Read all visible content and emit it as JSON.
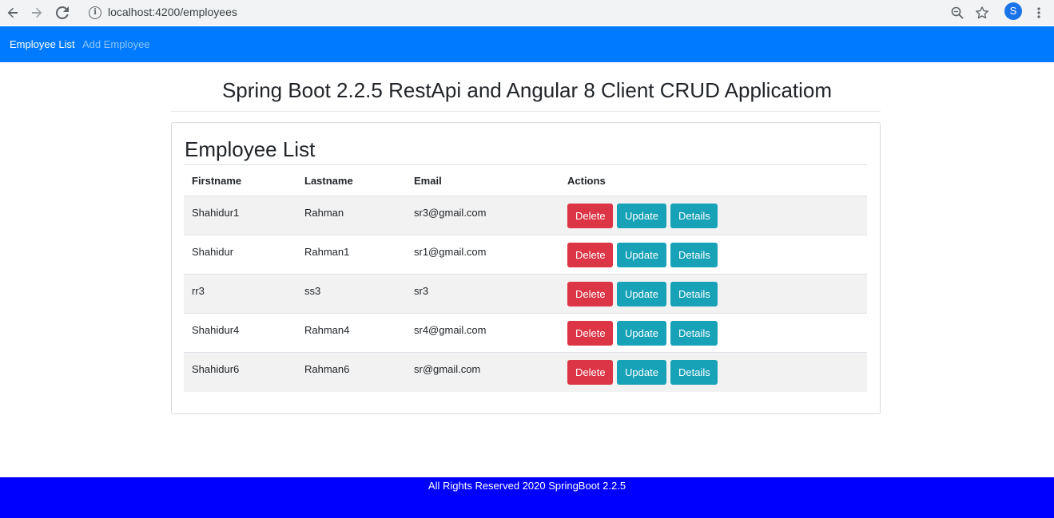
{
  "browser": {
    "url": "localhost:4200/employees",
    "profile_initial": "S",
    "icons": [
      "back-arrow-icon",
      "forward-arrow-icon",
      "reload-icon",
      "info-icon",
      "zoom-icon",
      "star-icon",
      "kebab-menu-icon"
    ]
  },
  "navbar": {
    "links": [
      {
        "label": "Employee List",
        "active": true
      },
      {
        "label": "Add Employee",
        "active": false
      }
    ],
    "color": "#007bff"
  },
  "page": {
    "title": "Spring Boot 2.2.5 RestApi and Angular 8 Client CRUD Applicatiom"
  },
  "card": {
    "title": "Employee List",
    "columns": [
      "Firstname",
      "Lastname",
      "Email",
      "Actions"
    ],
    "rows": [
      {
        "firstname": "Shahidur1",
        "lastname": "Rahman",
        "email": "sr3@gmail.com"
      },
      {
        "firstname": "Shahidur",
        "lastname": "Rahman1",
        "email": "sr1@gmail.com"
      },
      {
        "firstname": "rr3",
        "lastname": "ss3",
        "email": "sr3"
      },
      {
        "firstname": "Shahidur4",
        "lastname": "Rahman4",
        "email": "sr4@gmail.com"
      },
      {
        "firstname": "Shahidur6",
        "lastname": "Rahman6",
        "email": "sr@gmail.com"
      }
    ],
    "actions": {
      "delete": "Delete",
      "update": "Update",
      "details": "Details"
    },
    "colors": {
      "delete": "#dc3545",
      "info": "#17a2b8"
    }
  },
  "footer": {
    "text": "All Rights Reserved 2020 SpringBoot 2.2.5",
    "color": "#0000ff"
  }
}
